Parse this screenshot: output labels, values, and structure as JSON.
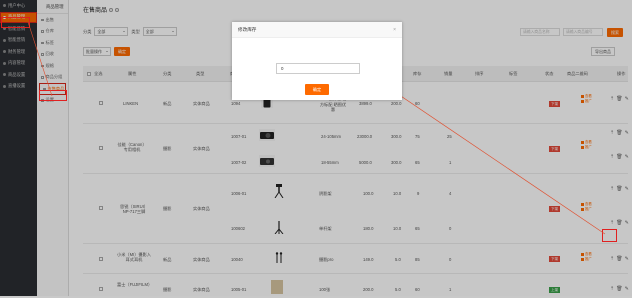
{
  "sidebar": {
    "user_label": "用户中心",
    "items": [
      {
        "label": "用户中心"
      },
      {
        "label": "商品管理"
      },
      {
        "label": "智能营销"
      },
      {
        "label": "智能营销"
      },
      {
        "label": "财务管理"
      },
      {
        "label": "内容管理"
      },
      {
        "label": "商品设置"
      },
      {
        "label": "直播设置"
      }
    ]
  },
  "subnav": {
    "title": "商品管理",
    "items": [
      {
        "label": "出售"
      },
      {
        "label": "仓库"
      },
      {
        "label": "标签"
      },
      {
        "label": "回收"
      },
      {
        "label": "规格"
      },
      {
        "label": "商品分组"
      },
      {
        "label": "在售商品"
      },
      {
        "label": "设置"
      }
    ]
  },
  "page": {
    "title": "在售商品",
    "filter_category_label": "分类",
    "filter_category_value": "全部",
    "filter_type_label": "类型",
    "filter_type_value": "全部",
    "search1_placeholder": "请输入商品名称",
    "search2_placeholder": "请输入商品编号",
    "search_button": "搜索",
    "batch_select": "批量操作",
    "batch_button": "确定",
    "export_button": "导出商品"
  },
  "table": {
    "headers": [
      "全选",
      "属性",
      "分类",
      "类型",
      "商品",
      "编号",
      "图片",
      "规格",
      "价格",
      "原价",
      "库存",
      "销量",
      "排序",
      "标签",
      "状态",
      "商品二维码",
      "操作"
    ],
    "rows": [
      {
        "check": "",
        "name": "LINKEN",
        "cat": "新品",
        "type": "实体商品",
        "code": "1094",
        "spec": "全网通 专享 4G全网通 128GB 4GB 操作版 官方标配 晒图优惠",
        "price": "3899.0",
        "orig": "200.0",
        "stock": "60",
        "sales": "",
        "status": "下架"
      },
      {
        "check": "",
        "name": "佳能（Canon）专用相机",
        "cat": "摄影",
        "type": "实体商品",
        "code": "1007-01",
        "spec": "24-105mm",
        "price": "23000.0",
        "orig": "300.0",
        "stock": "75",
        "sales": "25",
        "status": "下架"
      },
      {
        "check": "",
        "name": "",
        "cat": "",
        "type": "",
        "code": "1007-02",
        "spec": "18-55mm",
        "price": "5000.0",
        "orig": "300.0",
        "stock": "65",
        "sales": "1",
        "status": ""
      },
      {
        "check": "",
        "name": "思锐（SIRUI）NP-717三脚",
        "cat": "摄影",
        "type": "实体商品",
        "code": "1006-01",
        "spec": "阴影架",
        "price": "100.0",
        "orig": "10.0",
        "stock": "9",
        "sales": "4",
        "status": "下架"
      },
      {
        "check": "",
        "name": "",
        "cat": "",
        "type": "",
        "code": "100602",
        "spec": "单杆架",
        "price": "180.0",
        "orig": "10.0",
        "stock": "65",
        "sales": "0",
        "status": ""
      },
      {
        "check": "",
        "name": "小米（MI）摄影入耳式耳机",
        "cat": "新品",
        "type": "实体商品",
        "code": "10040",
        "spec": "摄影pro",
        "price": "149.0",
        "orig": "5.0",
        "stock": "85",
        "sales": "0",
        "status": "下架"
      },
      {
        "check": "",
        "name": "富士（FUJIFILM）",
        "cat": "摄影",
        "type": "实体商品",
        "code": "1005-01",
        "spec": "100张",
        "price": "200.0",
        "orig": "5.0",
        "stock": "60",
        "sales": "1",
        "status": "上架"
      }
    ],
    "qr_label": "查看",
    "qr_sub": "推广"
  },
  "modal": {
    "title": "修改库存",
    "close": "×",
    "input_value": "0",
    "confirm": "确定"
  },
  "colors": {
    "accent": "#fe6a00",
    "sidebar": "#2b2e33",
    "highlight": "#e02020"
  }
}
